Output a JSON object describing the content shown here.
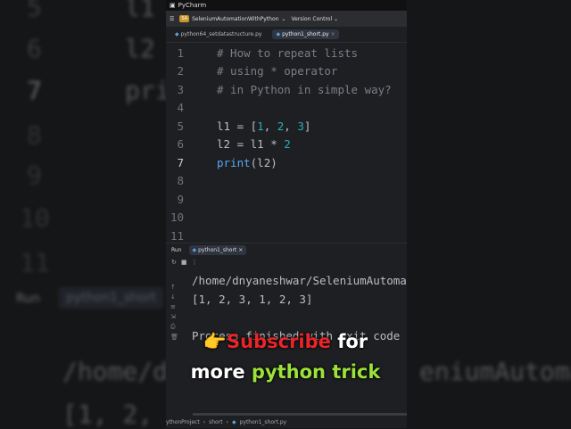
{
  "background": {
    "left_lines": [
      {
        "n": "5",
        "t": "l1"
      },
      {
        "n": "6",
        "t": "l2"
      },
      {
        "n": "7",
        "t": "prin"
      },
      {
        "n": "8",
        "t": ""
      },
      {
        "n": "9",
        "t": ""
      },
      {
        "n": "10",
        "t": ""
      },
      {
        "n": "11",
        "t": ""
      }
    ],
    "run_label": "Run",
    "run_tab": "python1_short",
    "out_path": "/home/d",
    "out_right": "eniumAutoma",
    "out_result": "[1, 2,"
  },
  "window": {
    "title": "PyCharm",
    "project_badge": "SA",
    "project": "SeleniumAutomationWithPython",
    "vcs": "Version Control",
    "tabs": [
      {
        "label": "python64_setdatastructure.py"
      },
      {
        "label": "python1_short.py"
      }
    ]
  },
  "editor": {
    "lines": [
      {
        "n": "1",
        "t": "# How to repeat lists"
      },
      {
        "n": "2",
        "t": "# using * operator"
      },
      {
        "n": "3",
        "t": "# in Python in simple way?"
      },
      {
        "n": "4",
        "t": ""
      },
      {
        "n": "5",
        "t": "l1 = [1, 2, 3]"
      },
      {
        "n": "6",
        "t": "l2 = l1 * 2"
      },
      {
        "n": "7",
        "t": "print(l2)"
      },
      {
        "n": "8",
        "t": ""
      },
      {
        "n": "9",
        "t": ""
      },
      {
        "n": "10",
        "t": ""
      },
      {
        "n": "11",
        "t": ""
      }
    ]
  },
  "run": {
    "label": "Run",
    "tab": "python1_short",
    "output": [
      "/home/dnyaneshwar/SeleniumAutoma",
      "[1, 2, 3, 1, 2, 3]",
      "",
      "Process finished with exit code"
    ]
  },
  "status": {
    "breadcrumb": [
      "ythonProject",
      "short",
      "python1_short.py"
    ]
  },
  "overlay": {
    "emoji": "👉",
    "line1_red": "Subscribe",
    "line1_white": " for",
    "line2_white": "more ",
    "line2_green": "python trick"
  }
}
